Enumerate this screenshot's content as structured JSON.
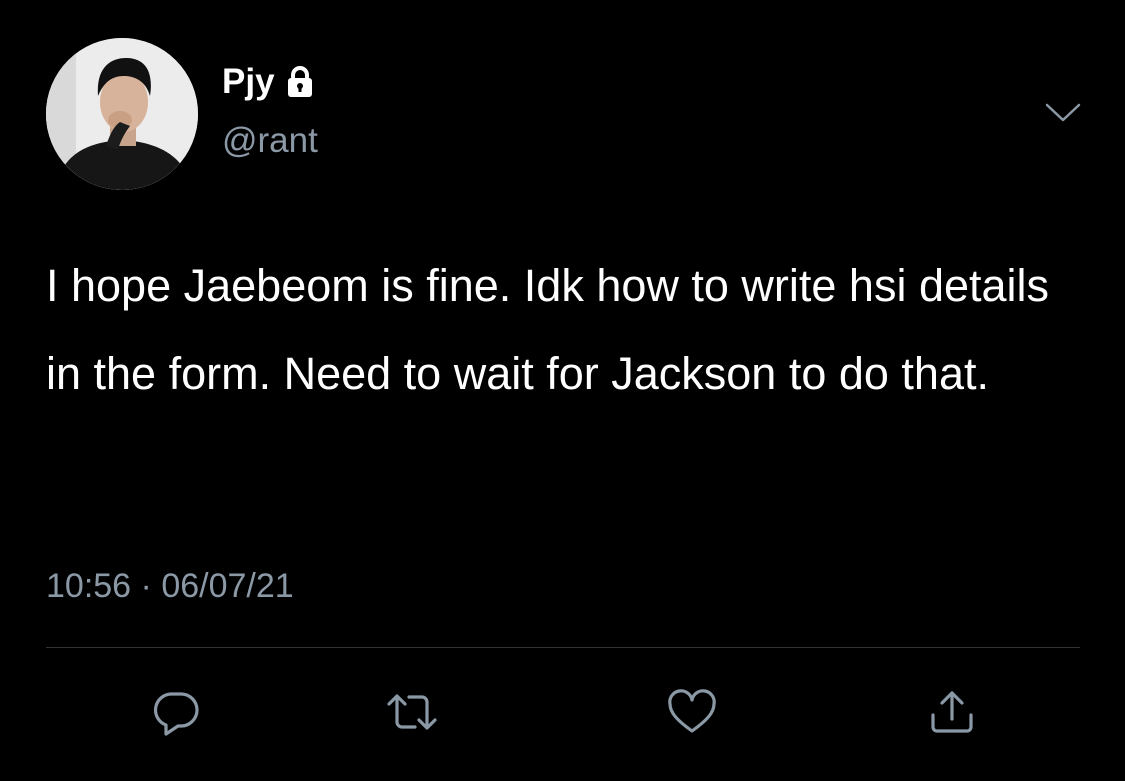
{
  "author": {
    "display_name": "Pjy",
    "handle": "@rant",
    "protected_icon": "lock-icon",
    "avatar": "profile-photo"
  },
  "tweet": {
    "text": "I hope Jaebeom is fine. Idk how to write hsi details in the form. Need to wait for Jackson to do that.",
    "time": "10:56",
    "separator": "·",
    "date": "06/07/21"
  },
  "menu_icon": "chevron-down-icon",
  "actions": [
    {
      "name": "reply",
      "icon": "reply-icon"
    },
    {
      "name": "retweet",
      "icon": "retweet-icon"
    },
    {
      "name": "like",
      "icon": "heart-icon"
    },
    {
      "name": "share",
      "icon": "share-icon"
    }
  ],
  "colors": {
    "background": "#000000",
    "primary_text": "#ffffff",
    "secondary_text": "#8b98a5",
    "divider": "#2f3336"
  }
}
